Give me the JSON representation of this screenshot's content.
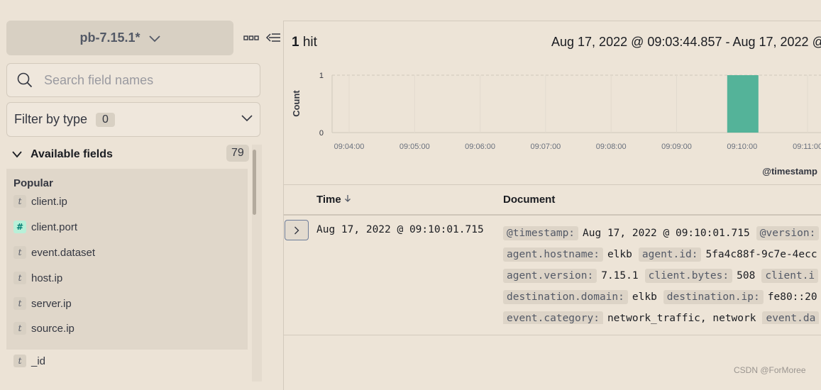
{
  "sidebar": {
    "index_pattern": "pb-7.15.1*",
    "search_placeholder": "Search field names",
    "filter_label": "Filter by type",
    "filter_count": "0",
    "available_fields_label": "Available fields",
    "available_fields_count": "79",
    "popular_label": "Popular",
    "popular_fields": [
      {
        "name": "client.ip",
        "type": "t"
      },
      {
        "name": "client.port",
        "type": "#"
      },
      {
        "name": "event.dataset",
        "type": "t"
      },
      {
        "name": "host.ip",
        "type": "t"
      },
      {
        "name": "server.ip",
        "type": "t"
      },
      {
        "name": "source.ip",
        "type": "t"
      }
    ],
    "other_fields": [
      {
        "name": "_id",
        "type": "t"
      }
    ]
  },
  "main": {
    "hits_count": "1",
    "hits_label": "hit",
    "time_range": "Aug 17, 2022 @ 09:03:44.857 - Aug 17, 2022 @",
    "table": {
      "time_header": "Time",
      "document_header": "Document",
      "rows": [
        {
          "time": "Aug 17, 2022 @ 09:10:01.715",
          "document_lines": [
            [
              [
                "@timestamp:",
                "Aug 17, 2022 @ 09:10:01.715"
              ],
              [
                "@version:",
                ""
              ]
            ],
            [
              [
                "agent.hostname:",
                "elkb"
              ],
              [
                "agent.id:",
                "5fa4c88f-9c7e-4ecc"
              ]
            ],
            [
              [
                "agent.version:",
                "7.15.1"
              ],
              [
                "client.bytes:",
                "508"
              ],
              [
                "client.i",
                ""
              ]
            ],
            [
              [
                "destination.domain:",
                "elkb"
              ],
              [
                "destination.ip:",
                "fe80::20"
              ]
            ],
            [
              [
                "event.category:",
                "network_traffic, network"
              ],
              [
                "event.da",
                ""
              ]
            ]
          ]
        }
      ]
    }
  },
  "chart_data": {
    "type": "bar",
    "title": "",
    "xlabel": "@timestamp",
    "ylabel": "Count",
    "ylim": [
      0,
      1
    ],
    "y_ticks": [
      "0",
      "1"
    ],
    "x_ticks": [
      "09:04:00",
      "09:05:00",
      "09:06:00",
      "09:07:00",
      "09:08:00",
      "09:09:00",
      "09:10:00",
      "09:11:00"
    ],
    "bars": [
      {
        "x": "09:10:00",
        "value": 1
      }
    ],
    "bar_color": "#54b399",
    "grid": true
  },
  "watermark": "CSDN @ForMoree"
}
